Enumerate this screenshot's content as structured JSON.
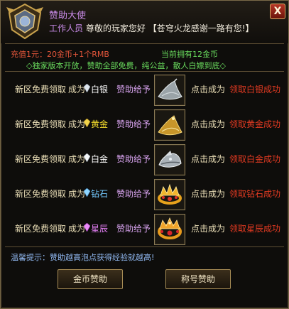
{
  "header": {
    "title": "赞助大使",
    "role": "工作人员",
    "greeting": "尊敬的玩家您好",
    "thanks": "【苍穹火龙感谢一路有您!】"
  },
  "info": {
    "rate": "充值1元：20金币+1个RMB",
    "current": "当前拥有12金币",
    "notice": "◇独家版本开放，赞助全部免费，纯公益，散人白嫖到底◇"
  },
  "rows": [
    {
      "free": "新区免费领取",
      "become": "成为",
      "tier": "白银",
      "give": "赞助给予",
      "click": "点击成为",
      "result": "领取白银成功",
      "tier_color": "#ffffff",
      "item_icon": "silver-hat-icon"
    },
    {
      "free": "新区免费领取",
      "become": "成为",
      "tier": "黄金",
      "give": "赞助给予",
      "click": "点击成为",
      "result": "领取黄金成功",
      "tier_color": "#f4dc2c",
      "item_icon": "gold-hat-icon"
    },
    {
      "free": "新区免费领取",
      "become": "成为",
      "tier": "白金",
      "give": "赞助给予",
      "click": "点击成为",
      "result": "领取白金成功",
      "tier_color": "#ffffff",
      "item_icon": "platinum-helmet-icon"
    },
    {
      "free": "新区免费领取",
      "become": "成为",
      "tier": "钻石",
      "give": "赞助给予",
      "click": "点击成为",
      "result": "领取钻石成功",
      "tier_color": "#74c9ff",
      "item_icon": "diamond-crown-icon"
    },
    {
      "free": "新区免费领取",
      "become": "成为",
      "tier": "星辰",
      "give": "赞助给予",
      "click": "点击成为",
      "result": "领取星辰成功",
      "tier_color": "#e27ef4",
      "item_icon": "star-crown-icon"
    }
  ],
  "tip": "温馨提示：赞助越高泡点获得经验就越高!",
  "buttons": {
    "gold": "金币赞助",
    "title": "称号赞助"
  },
  "colors": {
    "accent_gold": "#a88d56",
    "success_red": "#e23a22",
    "notice_green": "#68d85c",
    "tip_blue": "#8fb6ee"
  }
}
